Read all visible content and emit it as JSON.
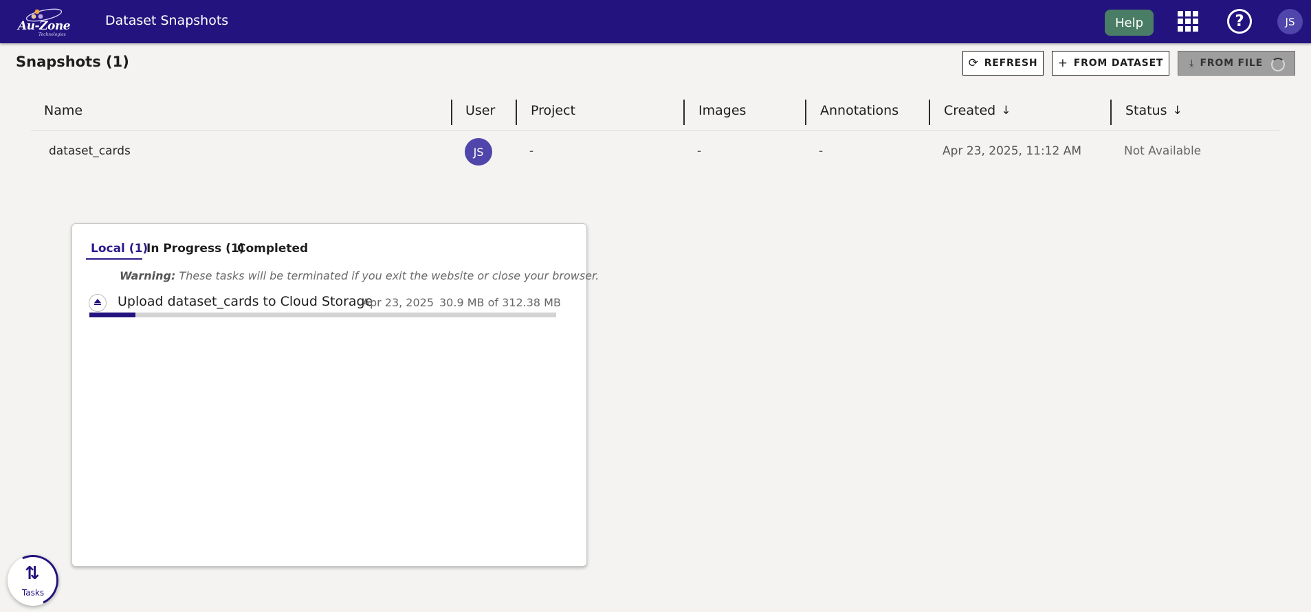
{
  "header": {
    "logo_text": "Au-Zone",
    "logo_subtext": "Technologies",
    "title": "Dataset Snapshots",
    "help_label": "Help",
    "user_initials": "JS",
    "icons": [
      "apps-grid-icon",
      "help-circle-icon"
    ]
  },
  "page": {
    "title": "Snapshots (1)"
  },
  "toolbar": {
    "refresh_label": "REFRESH",
    "from_dataset_label": "FROM DATASET",
    "from_file_label": "FROM FILE"
  },
  "table": {
    "columns": [
      "Name",
      "User",
      "Project",
      "Images",
      "Annotations",
      "Created",
      "Status"
    ],
    "sortable_indicator": "↓",
    "rows": [
      {
        "name": "dataset_cards",
        "user": "JS",
        "project": "-",
        "images": "-",
        "annotations": "-",
        "created": "Apr 23, 2025, 11:12 AM",
        "status": "Not Available"
      }
    ]
  },
  "tasks_panel": {
    "tabs": [
      "Local (1)",
      "In Progress (1)",
      "Completed"
    ],
    "active_tab": "Local (1)",
    "warning_label": "Warning:",
    "warning_text": "These tasks will be terminated if you exit the website or close your browser.",
    "task": {
      "name": "Upload dataset_cards to Cloud Storage",
      "date": "Apr 23, 2025",
      "size": "30.9 MB of 312.38 MB",
      "progress_fraction": 0.099
    }
  },
  "fab": {
    "label": "Tasks"
  },
  "colors": {
    "header_bg": "#23137f",
    "help_bg": "#4a7d65",
    "avatar_bg": "#5045aa",
    "progress_fill": "#23137f"
  }
}
